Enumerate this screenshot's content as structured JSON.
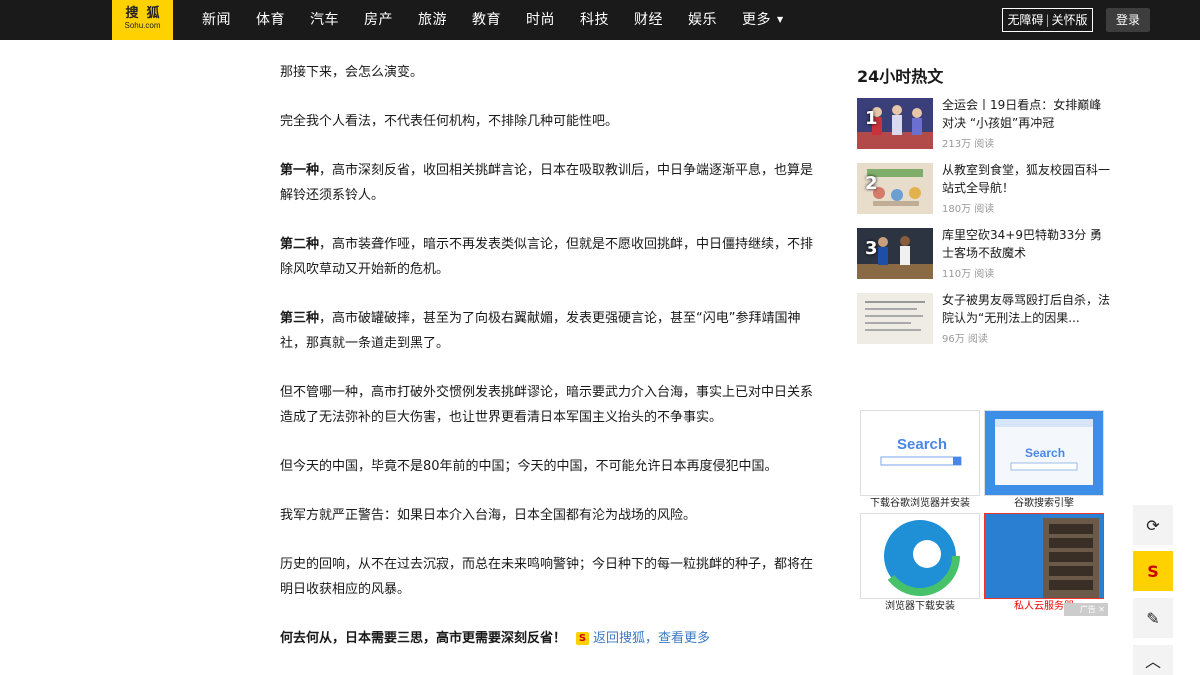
{
  "header": {
    "logo_cn": "搜狐",
    "logo_en": "Sohu.com",
    "nav": [
      "新闻",
      "体育",
      "汽车",
      "房产",
      "旅游",
      "教育",
      "时尚",
      "科技",
      "财经",
      "娱乐"
    ],
    "more_label": "更多",
    "access_left": "无障碍",
    "access_right": "关怀版",
    "login_label": "登录"
  },
  "article": {
    "p1": "那接下来，会怎么演变。",
    "p2": "完全我个人看法，不代表任何机构，不排除几种可能性吧。",
    "p3_lead": "第一种",
    "p3_text": "，高市深刻反省，收回相关挑衅言论，日本在吸取教训后，中日争端逐渐平息，也算是解铃还须系铃人。",
    "p4_lead": "第二种",
    "p4_text": "，高市装聋作哑，暗示不再发表类似言论，但就是不愿收回挑衅，中日僵持继续，不排除风吹草动又开始新的危机。",
    "p5_lead": "第三种",
    "p5_text": "，高市破罐破摔，甚至为了向极右翼献媚，发表更强硬言论，甚至“闪电”参拜靖国神社，那真就一条道走到黑了。",
    "p6": "但不管哪一种，高市打破外交惯例发表挑衅谬论，暗示要武力介入台海，事实上已对中日关系造成了无法弥补的巨大伤害，也让世界更看清日本军国主义抬头的不争事实。",
    "p7": "但今天的中国，毕竟不是80年前的中国；今天的中国，不可能允许日本再度侵犯中国。",
    "p8": "我军方就严正警告：如果日本介入台海，日本全国都有沦为战场的风险。",
    "p9": "历史的回响，从不在过去沉寂，而总在未来鸣响警钟；今日种下的每一粒挑衅的种子，都将在明日收获相应的风暴。",
    "p10": "何去何从，日本需要三思，高市更需要深刻反省！",
    "back_link": "返回搜狐，查看更多"
  },
  "hot": {
    "title": "24小时热文",
    "items": [
      {
        "num": "1",
        "title": "全运会丨19日看点：女排巅峰对决 “小孩姐”再冲冠",
        "reads": "213万 阅读"
      },
      {
        "num": "2",
        "title": "从教室到食堂，狐友校园百科一站式全导航！",
        "reads": "180万 阅读"
      },
      {
        "num": "3",
        "title": "库里空砍34+9巴特勒33分 勇士客场不敌魔术",
        "reads": "110万 阅读"
      },
      {
        "num": "",
        "title": "女子被男友辱骂殴打后自杀，法院认为“无刑法上的因果...",
        "reads": "96万 阅读"
      }
    ]
  },
  "ads": {
    "items": [
      {
        "caption": "下载谷歌浏览器并安装",
        "img_text": "Search"
      },
      {
        "caption": "谷歌搜索引擎",
        "img_text": "Search"
      },
      {
        "caption": "浏览器下载安装",
        "img_text": ""
      },
      {
        "caption": "私人云服务器",
        "img_text": ""
      }
    ],
    "tag": "广告"
  },
  "colors": {
    "brand_yellow": "#ffd100",
    "topbar_bg": "#1a1a1a",
    "link_blue": "#3d7ac4"
  }
}
